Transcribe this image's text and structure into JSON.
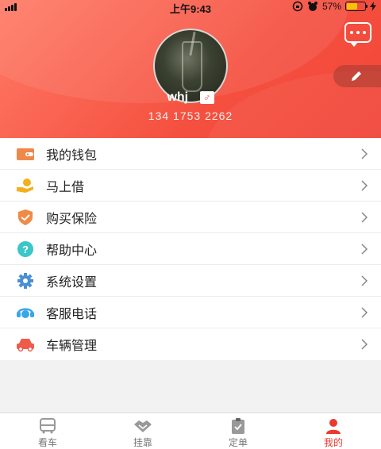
{
  "status_bar": {
    "time": "上午9:43",
    "battery_percent": "57%",
    "battery_level": 0.57
  },
  "profile": {
    "username": "whj",
    "gender_symbol": "♂",
    "phone": "134 1753 2262"
  },
  "header_icons": {
    "message": "message-icon",
    "edit": "edit-icon"
  },
  "menu": {
    "items": [
      {
        "label": "我的钱包",
        "icon": "wallet-icon",
        "color": "#f0884a"
      },
      {
        "label": "马上借",
        "icon": "loan-hand-icon",
        "color": "#f2b01e"
      },
      {
        "label": "购买保险",
        "icon": "insurance-shield-icon",
        "color": "#f08a45"
      },
      {
        "label": "帮助中心",
        "icon": "help-icon",
        "color": "#3cc6c8"
      },
      {
        "label": "系统设置",
        "icon": "settings-gear-icon",
        "color": "#4a8fd6"
      },
      {
        "label": "客服电话",
        "icon": "customer-service-icon",
        "color": "#3aa6e8"
      },
      {
        "label": "车辆管理",
        "icon": "car-icon",
        "color": "#ef5a4a"
      }
    ]
  },
  "tabbar": {
    "tabs": [
      {
        "label": "看车",
        "icon": "bus-icon",
        "active": false
      },
      {
        "label": "挂靠",
        "icon": "handshake-icon",
        "active": false
      },
      {
        "label": "定单",
        "icon": "order-clipboard-icon",
        "active": false
      },
      {
        "label": "我的",
        "icon": "user-icon",
        "active": true
      }
    ]
  },
  "colors": {
    "accent": "#f2503e",
    "tab_active": "#e83a2f",
    "tab_inactive": "#777777"
  }
}
